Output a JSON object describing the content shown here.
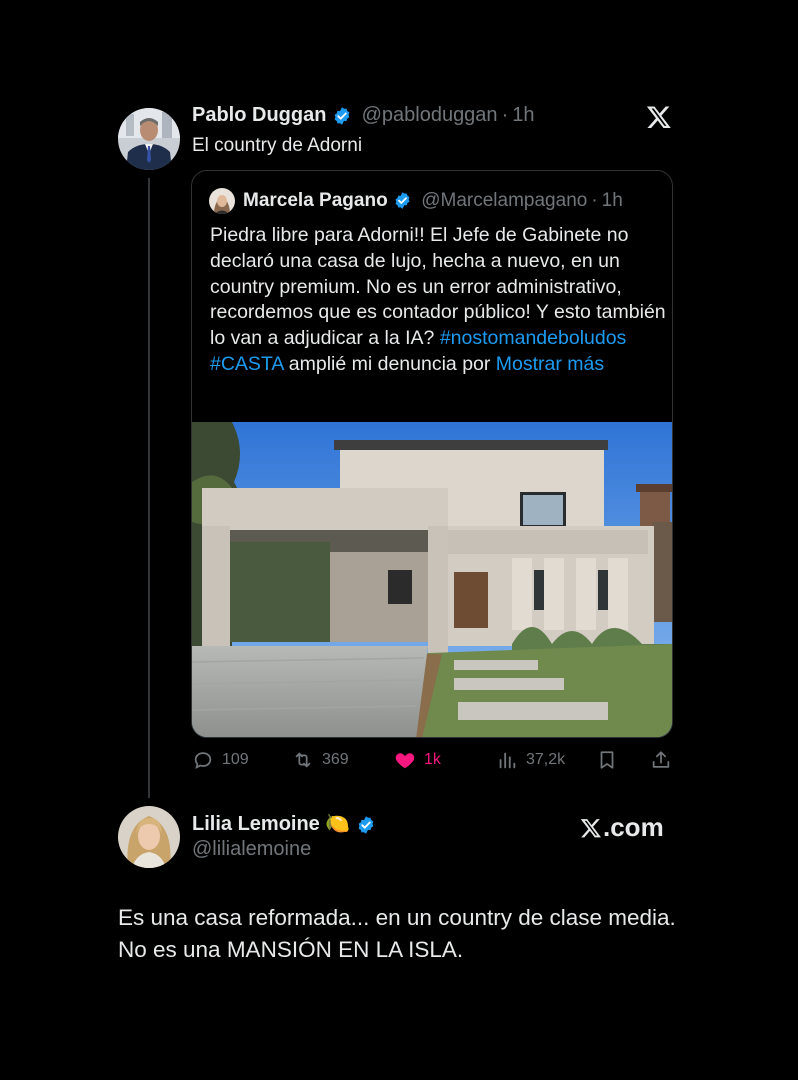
{
  "tweet1": {
    "author_name": "Pablo Duggan",
    "handle": "@pabloduggan",
    "separator": "·",
    "time": "1h",
    "text": "El country de Adorni"
  },
  "quote": {
    "author_name": "Marcela Pagano",
    "handle": "@Marcelampagano",
    "separator": "·",
    "time": "1h",
    "text_plain_1": "Piedra libre para Adorni!! El Jefe de Gabinete no declaró una casa de lujo, hecha a nuevo, en un country premium. No es un error administrativo, recordemos que es contador público! Y esto también lo van a adjudicar a la IA?",
    "hashtag_1": "#nostomandeboludos",
    "hashtag_2": "#CASTA",
    "text_plain_2": "amplié mi denuncia por",
    "show_more": "Mostrar más"
  },
  "actions": {
    "replies": "109",
    "reposts": "369",
    "likes": "1k",
    "views": "37,2k"
  },
  "tweet2": {
    "author_name": "Lilia Lemoine",
    "emoji": "🍋",
    "handle": "@lilialemoine",
    "text": "Es una casa reformada... en un country de clase media. No es una MANSIÓN EN LA ISLA."
  },
  "watermark": {
    "domain_suffix": ".com"
  },
  "icons": {
    "verified": "verified-badge-icon",
    "x_logo": "x-logo-icon",
    "reply": "reply-icon",
    "repost": "repost-icon",
    "like": "heart-icon",
    "views": "views-icon",
    "bookmark": "bookmark-icon",
    "share": "share-icon"
  },
  "colors": {
    "background": "#000000",
    "text": "#e7e9ea",
    "muted": "#71767b",
    "link": "#1d9bf0",
    "like": "#f91880",
    "verified": "#1d9bf0"
  }
}
